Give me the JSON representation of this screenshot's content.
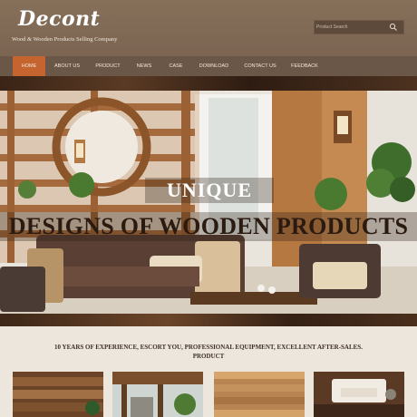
{
  "header": {
    "logo": "Decont",
    "tagline": "Wood & Wooden Products Selling Company"
  },
  "search": {
    "placeholder": "Product Search",
    "icon": "search-icon"
  },
  "nav": {
    "items": [
      {
        "label": "HOME",
        "active": true
      },
      {
        "label": "ABOUT US"
      },
      {
        "label": "PRODUCT"
      },
      {
        "label": "NEWS"
      },
      {
        "label": "CASE"
      },
      {
        "label": "DOWNLOAD"
      },
      {
        "label": "CONTACT US"
      },
      {
        "label": "FEEDBACK"
      }
    ]
  },
  "hero": {
    "title_line1": "UNIQUE",
    "title_line2": "DESIGNS OF WOODEN PRODUCTS"
  },
  "content": {
    "tagline": "10 YEARS OF EXPERIENCE, ESCORT YOU, PROFESSIONAL EQUIPMENT, EXCELLENT AFTER-SALES.",
    "section_label": "PRODUCT"
  },
  "colors": {
    "header_bg": "#7f6955",
    "nav_bg": "#6b5747",
    "nav_active": "#c5642e",
    "page_bg": "#ece6dc"
  }
}
